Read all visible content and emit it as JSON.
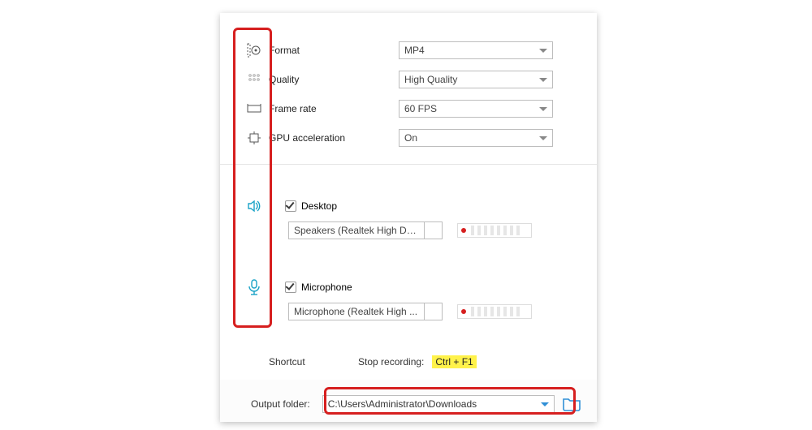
{
  "video": {
    "format_label": "Format",
    "format_value": "MP4",
    "quality_label": "Quality",
    "quality_value": "High Quality",
    "framerate_label": "Frame rate",
    "framerate_value": "60 FPS",
    "gpu_label": "GPU acceleration",
    "gpu_value": "On"
  },
  "audio": {
    "desktop_label": "Desktop",
    "desktop_checked": true,
    "desktop_device": "Speakers (Realtek High De...",
    "mic_label": "Microphone",
    "mic_checked": true,
    "mic_device": "Microphone (Realtek High ..."
  },
  "shortcut": {
    "section_label": "Shortcut",
    "stop_label": "Stop recording:",
    "stop_key": "Ctrl + F1"
  },
  "output": {
    "label": "Output folder:",
    "path": "C:\\Users\\Administrator\\Downloads"
  }
}
